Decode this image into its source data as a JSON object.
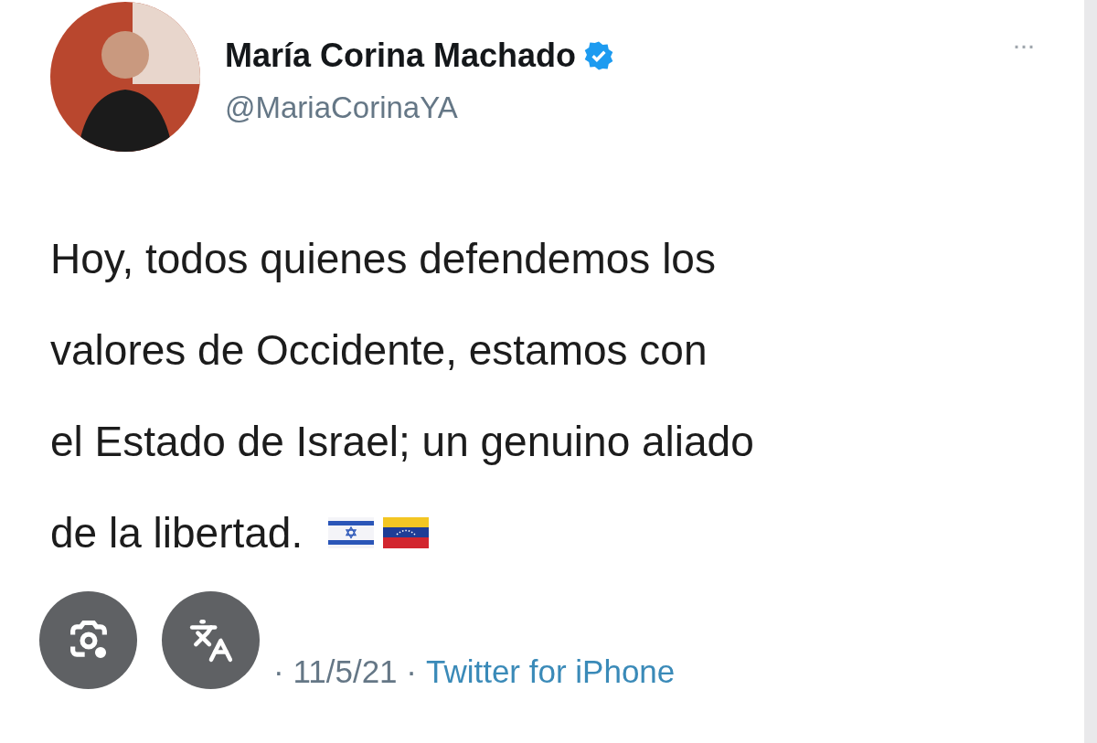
{
  "tweet": {
    "author": {
      "name": "María Corina Machado",
      "verified": true,
      "handle": "@MariaCorinaYA"
    },
    "menu": "···",
    "text_lines": [
      "Hoy, todos quienes defendemos los",
      "valores de Occidente, estamos con",
      "el Estado de Israel; un genuino aliado",
      "de la libertad."
    ],
    "date": "· 11/5/21 ·",
    "source": "Twitter for iPhone"
  }
}
